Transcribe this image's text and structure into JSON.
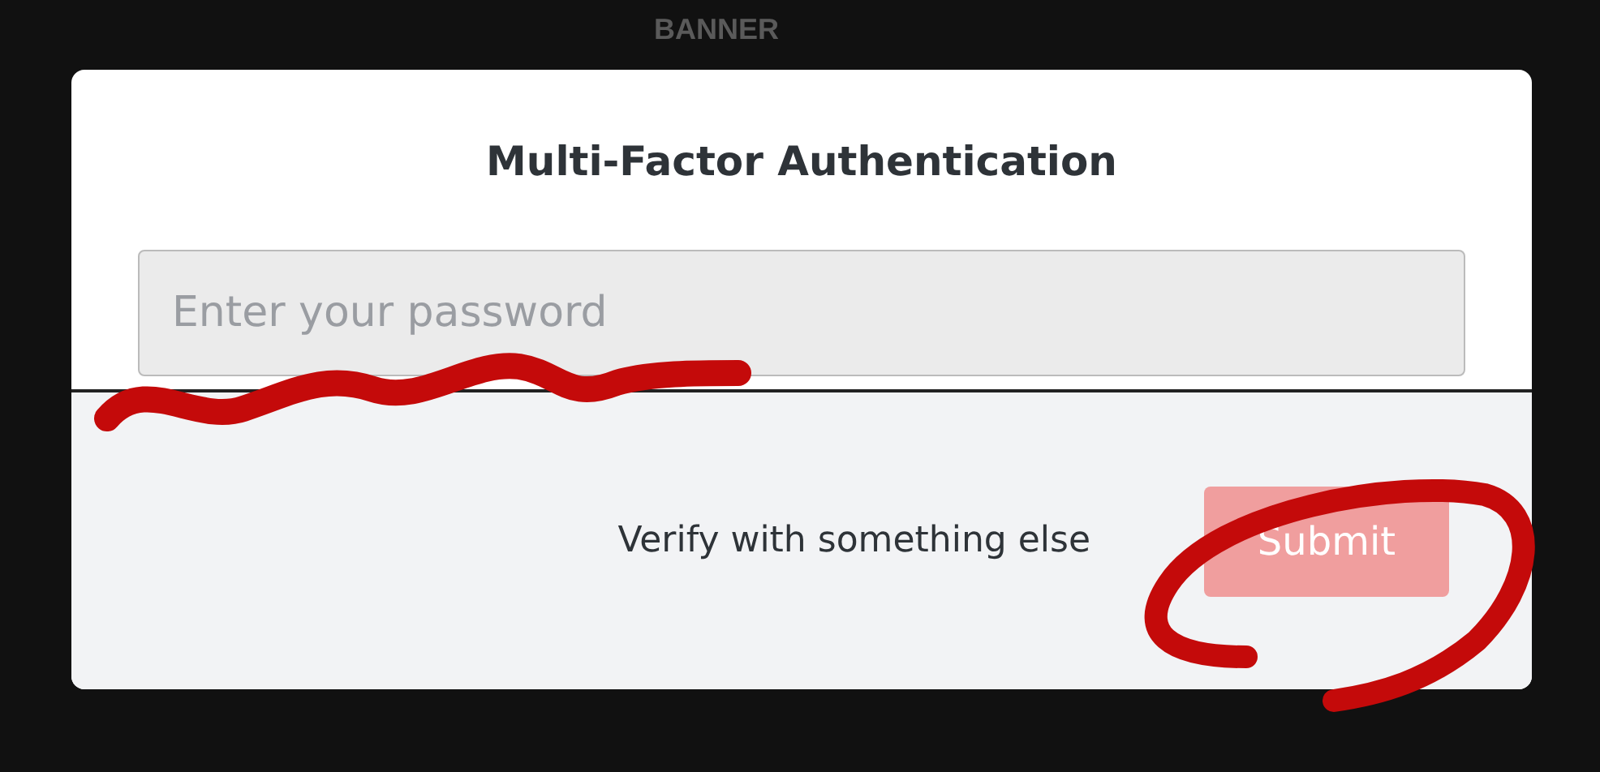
{
  "background": {
    "labels": [
      "BANNER"
    ]
  },
  "dialog": {
    "title": "Multi-Factor Authentication",
    "password_field": {
      "placeholder": "Enter your password"
    },
    "footer": {
      "link": "Verify with something else",
      "submit": {
        "label": "Submit",
        "disabled": true
      }
    }
  }
}
